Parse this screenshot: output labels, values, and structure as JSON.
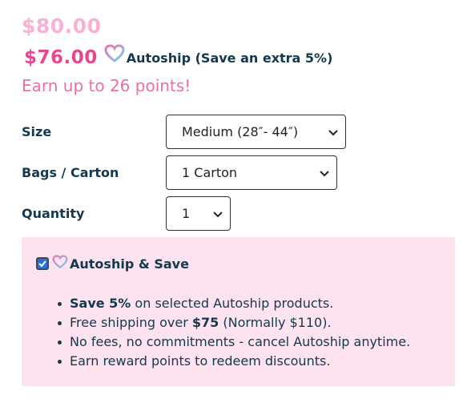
{
  "pricing": {
    "original_price": "$80.00",
    "sale_price": "$76.00",
    "autoship_label": "Autoship (Save an extra 5%)",
    "points_text": "Earn up to 26 points!"
  },
  "options": {
    "size": {
      "label": "Size",
      "selected": "Medium (28″- 44″)"
    },
    "bags": {
      "label": "Bags / Carton",
      "selected": "1 Carton"
    },
    "quantity": {
      "label": "Quantity",
      "selected": "1"
    }
  },
  "autoship_panel": {
    "checked": true,
    "title": "Autoship & Save",
    "bullets": [
      {
        "bold": "Save 5%",
        "rest": " on selected Autoship products."
      },
      {
        "pre": "Free shipping over ",
        "bold": "$75",
        "rest": " (Normally $110)."
      },
      {
        "text": "No fees, no commitments - cancel Autoship anytime."
      },
      {
        "text": "Earn reward points to redeem discounts."
      }
    ]
  },
  "colors": {
    "sale_pink": "#e8478f",
    "old_price_pink": "#f7b2d3",
    "panel_bg": "#fde2ef",
    "text_navy": "#12394f"
  }
}
